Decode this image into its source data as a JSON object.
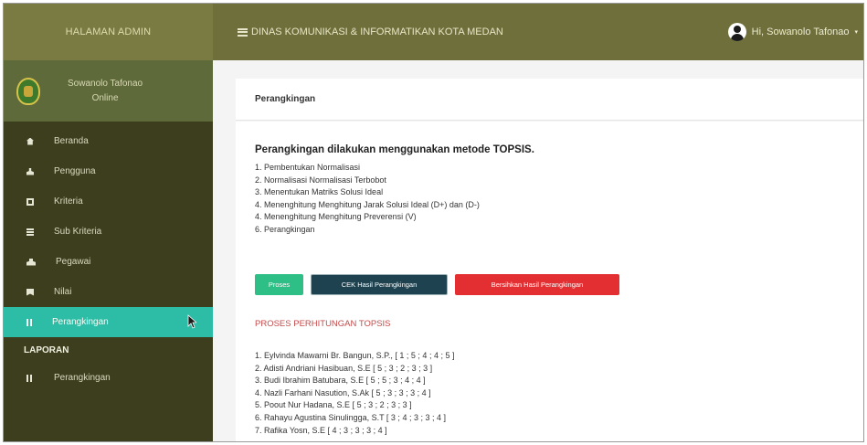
{
  "header": {
    "brand": "HALAMAN ADMIN",
    "title": "DINAS KOMUNIKASI & INFORMATIKAN KOTA MEDAN",
    "user_greeting": "Hi, Sowanolo Tafonao"
  },
  "sidebar": {
    "profile_name": "Sowanolo Tafonao",
    "profile_status": "Online",
    "items": [
      {
        "label": "Beranda",
        "icon": "home-icon"
      },
      {
        "label": "Pengguna",
        "icon": "user-icon"
      },
      {
        "label": "Kriteria",
        "icon": "table-icon"
      },
      {
        "label": "Sub Kriteria",
        "icon": "list-icon"
      },
      {
        "label": "Pegawai",
        "icon": "users-icon"
      },
      {
        "label": "Nilai",
        "icon": "bookmark-icon"
      },
      {
        "label": "Perangkingan",
        "icon": "bars-icon",
        "active": true
      }
    ],
    "section_label": "LAPORAN",
    "report_items": [
      {
        "label": "Perangkingan",
        "icon": "bars-icon"
      }
    ]
  },
  "main": {
    "card_title": "Perangkingan",
    "heading": "Perangkingan dilakukan menggunakan metode TOPSIS.",
    "steps": [
      "1. Pembentukan Normalisasi",
      "2. Normalisasi Normalisasi Terbobot",
      "3. Menentukan Matriks Solusi Ideal",
      "4. Menenghitung Menghitung Jarak Solusi Ideal (D+) dan (D-)",
      "4. Menenghitung Menghitung Preverensi (V)",
      "6. Perangkingan"
    ],
    "buttons": {
      "proses": "Proses",
      "cek": "CEK Hasil Perangkingan",
      "hapus": "Bersihkan Hasil Perangkingan"
    },
    "process_title": "PROSES PERHITUNGAN TOPSIS",
    "results": [
      "1. Eylvinda Mawarni Br. Bangun, S.P., [ 1 ; 5 ; 4 ; 4 ; 5 ]",
      "2. Adisti Andriani Hasibuan, S.E [ 5 ; 3 ; 2 ; 3 ; 3 ]",
      "3. Budi Ibrahim Batubara, S.E [ 5 ; 5 ; 3 ; 4 ; 4 ]",
      "4. Nazli Farhani Nasution, S.Ak [ 5 ; 3 ; 3 ; 3 ; 4 ]",
      "5. Poout Nur Hadana, S.E [ 5 ; 3 ; 2 ; 3 ; 3 ]",
      "6. Rahayu Agustina Sinulingga, S.T [ 3 ; 4 ; 3 ; 3 ; 4 ]",
      "7. Rafika Yosn, S.E [ 4 ; 3 ; 3 ; 3 ; 4 ]"
    ]
  },
  "colors": {
    "topbar": "#6e6f3a",
    "sidebar": "#3d3e1e",
    "active_item": "#2dbca5",
    "btn_proses": "#2dbf85",
    "btn_cek": "#1e4250",
    "btn_hapus": "#e42f32"
  }
}
